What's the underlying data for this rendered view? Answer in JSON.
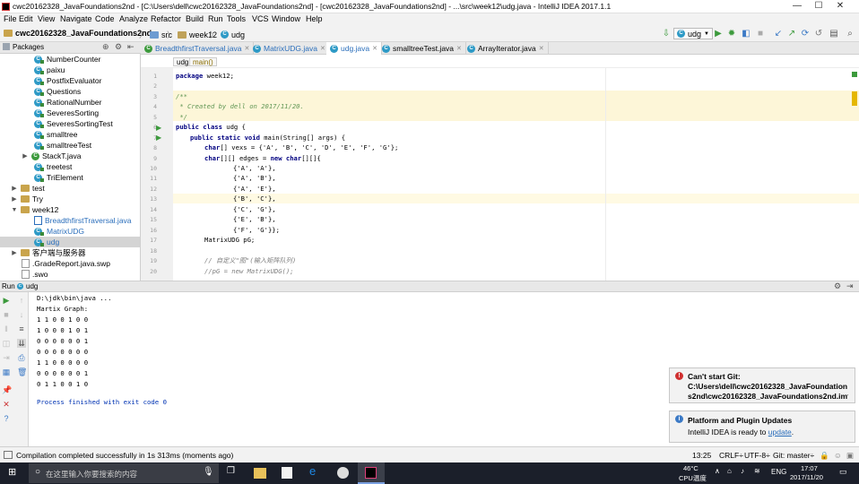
{
  "window": {
    "title": "cwc20162328_JavaFoundations2nd - [C:\\Users\\dell\\cwc20162328_JavaFoundations2nd] - [cwc20162328_JavaFoundations2nd] - ...\\src\\week12\\udg.java - IntelliJ IDEA 2017.1.1",
    "minimize": "—",
    "maximize": "☐",
    "close": "✕"
  },
  "menu": [
    "File",
    "Edit",
    "View",
    "Navigate",
    "Code",
    "Analyze",
    "Refactor",
    "Build",
    "Run",
    "Tools",
    "VCS",
    "Window",
    "Help"
  ],
  "nav": {
    "project": "cwc20162328_JavaFoundations2nd",
    "src": "src",
    "pkg": "week12",
    "file": "udg",
    "run_config": "udg"
  },
  "project_panel": {
    "title": "Packages",
    "items": [
      {
        "label": "NumberCounter",
        "kind": "class"
      },
      {
        "label": "paixu",
        "kind": "class"
      },
      {
        "label": "PostfixEvaluator",
        "kind": "class"
      },
      {
        "label": "Questions",
        "kind": "class"
      },
      {
        "label": "RationalNumber",
        "kind": "class"
      },
      {
        "label": "SeveresSorting",
        "kind": "class"
      },
      {
        "label": "SeveresSortingTest",
        "kind": "class"
      },
      {
        "label": "smalltree",
        "kind": "class"
      },
      {
        "label": "smalltreeTest",
        "kind": "class"
      },
      {
        "label": "StackT.java",
        "kind": "file"
      },
      {
        "label": "treetest",
        "kind": "class"
      },
      {
        "label": "TriElement",
        "kind": "class"
      },
      {
        "label": "test",
        "kind": "folder"
      },
      {
        "label": "Try",
        "kind": "folder"
      },
      {
        "label": "week12",
        "kind": "folder"
      },
      {
        "label": "BreadthfirstTraversal.java",
        "kind": "jfile"
      },
      {
        "label": "MatrixUDG",
        "kind": "class"
      },
      {
        "label": "udg",
        "kind": "class"
      },
      {
        "label": "客户端与服务器",
        "kind": "folder"
      },
      {
        "label": ".GradeReport.java.swp",
        "kind": "txt"
      },
      {
        "label": ".swo",
        "kind": "txt"
      }
    ]
  },
  "tabs": [
    "BreadthfirstTraversal.java",
    "MatrixUDG.java",
    "udg.java",
    "smalltreeTest.java",
    "ArrayIterator.java"
  ],
  "active_tab": "udg.java",
  "editor_breadcrumb": [
    "udg",
    "main()"
  ],
  "code": {
    "line_numbers": [
      "1",
      "2",
      "3",
      "4",
      "5",
      "6",
      "7",
      "8",
      "9",
      "10",
      "11",
      "12",
      "13",
      "14",
      "15",
      "16",
      "17",
      "18",
      "19",
      "20"
    ],
    "l1_kw": "package",
    "l1_rest": " week12;",
    "l3": "/**",
    "l4": " * Created by dell on 2017/11/20.",
    "l5": " */",
    "l6_kw": "public class",
    "l6_rest": " udg {",
    "l7_kw1": "public static void",
    "l7_rest": " main(String[] args) {",
    "l8_kw": "char",
    "l8_rest": "[] vexs = {'A', 'B', 'C', 'D', 'E', 'F', 'G'};",
    "l9_kw": "char",
    "l9_mid": "[][] edges = ",
    "l9_kw2": "new char",
    "l9_rest": "[][]{",
    "l10": "{'A', 'A'},",
    "l11": "{'A', 'B'},",
    "l12": "{'A', 'E'},",
    "l13": "{'B', 'C'},",
    "l14": "{'C', 'G'},",
    "l15": "{'E', 'B'},",
    "l16": "{'F', 'G'}};",
    "l17": "MatrixUDG pG;",
    "l19": "// 自定义\"图\"(输入矩阵队列)",
    "l20": "//pG = new MatrixUDG();"
  },
  "run_panel": {
    "label": "Run",
    "config": "udg",
    "output": [
      "D:\\jdk\\bin\\java ...",
      "Martix Graph:",
      "1 1 0 0 1 0 0",
      "1 0 0 0 1 0 1",
      "0 0 0 0 0 0 1",
      "0 0 0 0 0 0 0",
      "1 1 0 0 0 0 0",
      "0 0 0 0 0 0 1",
      "0 1 1 0 0 1 0",
      "",
      "Process finished with exit code 0"
    ]
  },
  "notifications": {
    "git_title": "Can't start Git:",
    "git_line1": "C:\\Users\\dell\\cwc20162328_JavaFoundation",
    "git_line2": "s2nd\\cwc20162328_JavaFoundations2nd.im",
    "update_title": "Platform and Plugin Updates",
    "update_text": "IntelliJ IDEA is ready to",
    "update_link": "update",
    "update_tail": "."
  },
  "status": {
    "message": "Compilation completed successfully in 1s 313ms (moments ago)",
    "pos": "13:25",
    "line_sep": "CRLF÷",
    "encoding": "UTF-8÷",
    "git": "Git: master÷"
  },
  "taskbar": {
    "search_placeholder": "在这里输入你要搜索的内容",
    "temp": "46°C",
    "temp_label": "CPU温度",
    "lang": "ENG",
    "time": "17:07",
    "date": "2017/11/20"
  },
  "colors": {
    "accent": "#2e9ac6",
    "keyword": "#000080",
    "string": "#008000",
    "doc_highlight": "#fdf6d8",
    "run_green": "#3c9a3c",
    "taskbar": "#1b1f2a"
  }
}
